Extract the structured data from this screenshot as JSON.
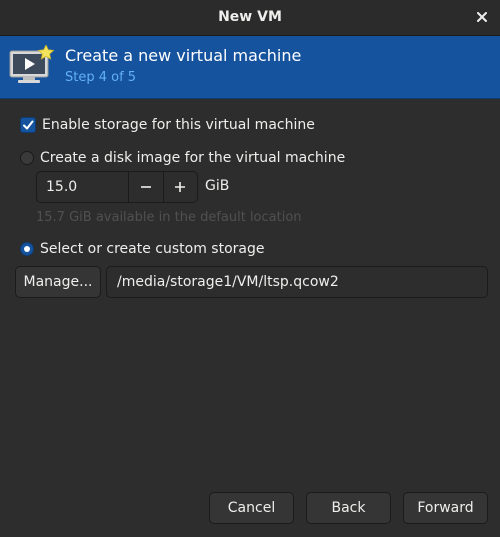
{
  "window": {
    "title": "New VM"
  },
  "banner": {
    "heading": "Create a new virtual machine",
    "step": "Step 4 of 5"
  },
  "storage": {
    "enable_label": "Enable storage for this virtual machine",
    "enable_checked": true,
    "disk_image_label": "Create a disk image for the virtual machine",
    "size_value": "15.0",
    "size_unit": "GiB",
    "available_text": "15.7 GiB available in the default location",
    "custom_label": "Select or create custom storage",
    "selected_option": "custom",
    "manage_label": "Manage...",
    "path_value": "/media/storage1/VM/ltsp.qcow2"
  },
  "footer": {
    "cancel_label": "Cancel",
    "back_label": "Back",
    "forward_label": "Forward"
  },
  "icons": {
    "close": "close-icon",
    "vm": "vm-monitor-icon",
    "check": "checkmark-icon",
    "minus": "minus-icon",
    "plus": "plus-icon"
  },
  "colors": {
    "accent": "#15539e",
    "step_text": "#62b0f5",
    "background": "#2d2d2d"
  }
}
